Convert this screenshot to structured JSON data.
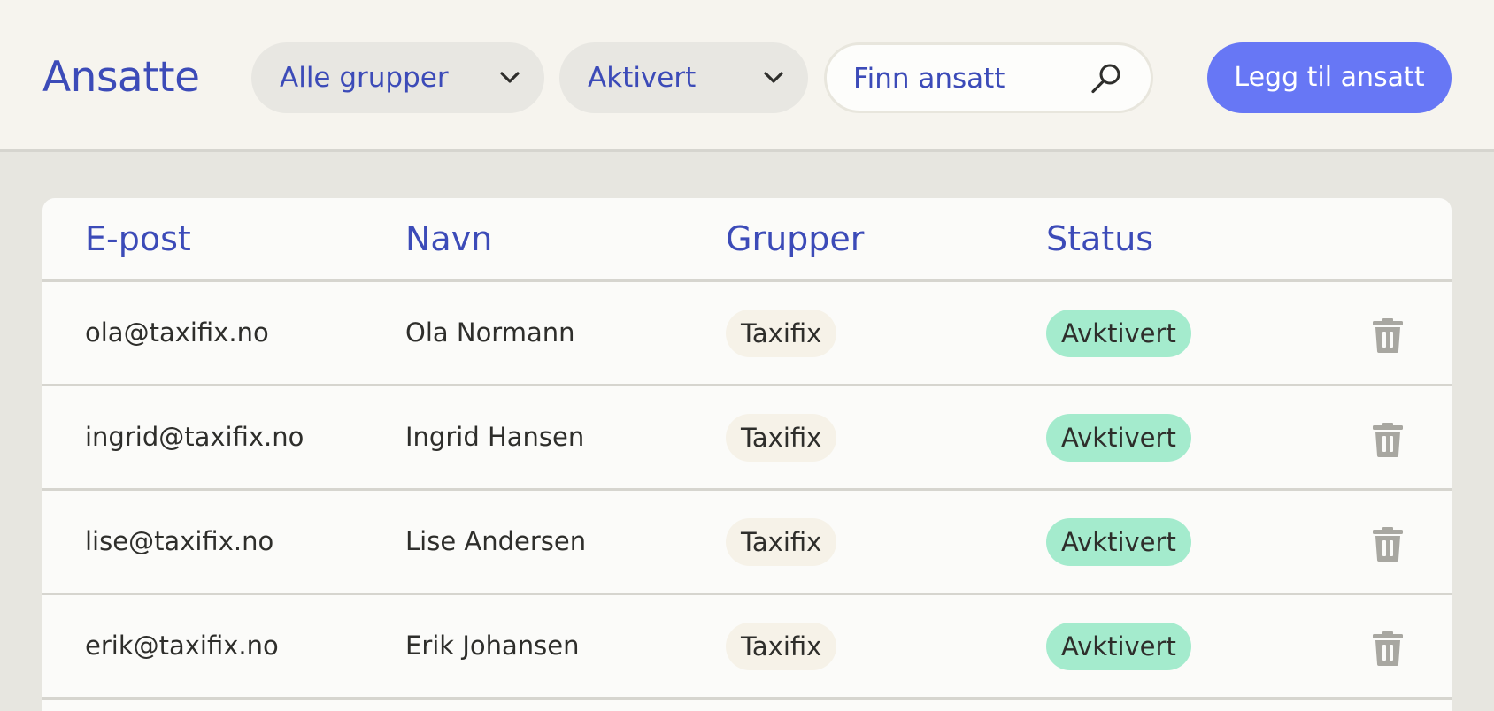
{
  "header": {
    "title": "Ansatte",
    "group_filter": {
      "selected": "Alle grupper"
    },
    "status_filter": {
      "selected": "Aktivert"
    },
    "search": {
      "placeholder": "Finn ansatt"
    },
    "add_button_label": "Legg til ansatt"
  },
  "table": {
    "columns": [
      "E-post",
      "Navn",
      "Grupper",
      "Status"
    ],
    "rows": [
      {
        "email": "ola@taxifix.no",
        "name": "Ola Normann",
        "group": "Taxifix",
        "status": "Avktivert"
      },
      {
        "email": "ingrid@taxifix.no",
        "name": "Ingrid Hansen",
        "group": "Taxifix",
        "status": "Avktivert"
      },
      {
        "email": "lise@taxifix.no",
        "name": "Lise Andersen",
        "group": "Taxifix",
        "status": "Avktivert"
      },
      {
        "email": "erik@taxifix.no",
        "name": "Erik Johansen",
        "group": "Taxifix",
        "status": "Avktivert"
      }
    ]
  },
  "icons": {
    "dropdown": "chevron-down-icon",
    "search": "search-icon",
    "delete": "trash-icon"
  },
  "colors": {
    "accent": "#3c4bb8",
    "primary_button": "#6777f5",
    "status_badge": "#a4ebcd",
    "group_chip": "#f6f2e8",
    "header_bg": "#f6f4ee",
    "page_bg": "#e7e6e0",
    "trash_icon": "#a8a7a1"
  }
}
